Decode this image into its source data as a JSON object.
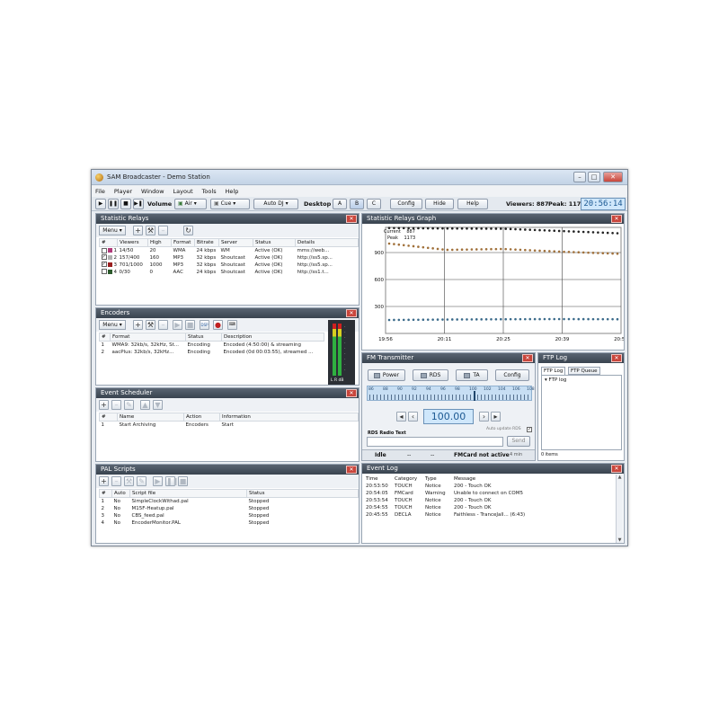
{
  "window": {
    "title": "SAM Broadcaster - Demo Station"
  },
  "menu": [
    "File",
    "Player",
    "Window",
    "Layout",
    "Tools",
    "Help"
  ],
  "toolbar": {
    "volume_label": "Volume",
    "air": "Air",
    "cue": "Cue",
    "autodj": "Auto DJ",
    "desktop_label": "Desktop",
    "desktop_buttons": [
      "A",
      "B",
      "C"
    ],
    "config": "Config",
    "hide": "Hide",
    "help": "Help",
    "viewers": "Viewers: 887",
    "peak": "Peak: 1173",
    "clock": "20:56:14"
  },
  "statistic_relays": {
    "title": "Statistic Relays",
    "menu": "Menu",
    "columns": [
      "#",
      "Viewers",
      "High",
      "Format",
      "Bitrate",
      "Server",
      "Status",
      "Details"
    ],
    "rows": [
      {
        "num": "1",
        "viewers": "14/50",
        "high": "20",
        "format": "WMA",
        "bitrate": "24 kbps",
        "server": "WM",
        "status": "Active (OK)",
        "details": "mms://web...",
        "checked": false,
        "color": "#b03a7a"
      },
      {
        "num": "2",
        "viewers": "157/400",
        "high": "160",
        "format": "MP3",
        "bitrate": "32 kbps",
        "server": "Shoutcast",
        "status": "Active (OK)",
        "details": "http://ss5.sp...",
        "checked": true,
        "color": "#b0b0b0"
      },
      {
        "num": "3",
        "viewers": "701/1000",
        "high": "1000",
        "format": "MP3",
        "bitrate": "32 kbps",
        "server": "Shoutcast",
        "status": "Active (OK)",
        "details": "http://ss5.sp...",
        "checked": true,
        "color": "#9a2020"
      },
      {
        "num": "4",
        "viewers": "0/30",
        "high": "0",
        "format": "AAC",
        "bitrate": "24 kbps",
        "server": "Shoutcast",
        "status": "Active (OK)",
        "details": "http://ss1.t...",
        "checked": false,
        "color": "#2d5a2d"
      }
    ]
  },
  "graph": {
    "title": "Statistic Relays Graph",
    "legend_current": "Current",
    "legend_current_value": "887",
    "legend_peak": "Peak",
    "legend_peak_value": "1173",
    "y_ticks": [
      "900",
      "600",
      "300"
    ],
    "x_ticks": [
      "19:56",
      "20:11",
      "20:25",
      "20:39",
      "20:54"
    ]
  },
  "chart_data": {
    "type": "scatter",
    "x": [
      "19:56",
      "20:11",
      "20:25",
      "20:39",
      "20:54"
    ],
    "ylim": [
      0,
      1180
    ],
    "series": [
      {
        "name": "Peak",
        "values": [
          1173,
          1168,
          1165,
          1140,
          1115
        ],
        "color": "#222222"
      },
      {
        "name": "Current",
        "values": [
          1000,
          930,
          940,
          910,
          887
        ],
        "color": "#a0703a"
      },
      {
        "values": [
          150,
          155,
          158,
          160,
          158
        ],
        "color": "#3a6a8a"
      }
    ]
  },
  "encoders": {
    "title": "Encoders",
    "menu": "Menu",
    "columns": [
      "#",
      "Format",
      "Status",
      "Description"
    ],
    "rows": [
      {
        "num": "1",
        "format": "WMA9: 32kb/s, 32kHz, St...",
        "status": "Encoding",
        "description": "Encoded (4:50:00) & streaming"
      },
      {
        "num": "2",
        "format": "aacPlus: 32kb/s, 32kHz...",
        "status": "Encoding",
        "description": "Encoded (0d 00:03:55), streamed ..."
      }
    ],
    "vu_label": "L R dB"
  },
  "event_scheduler": {
    "title": "Event Scheduler",
    "columns": [
      "#",
      "Name",
      "Action",
      "Information"
    ],
    "rows": [
      {
        "num": "1",
        "name": "Start Archiving",
        "action": "Encoders",
        "info": "Start"
      }
    ]
  },
  "pal_scripts": {
    "title": "PAL Scripts",
    "columns": [
      "#",
      "Auto",
      "Script file",
      "Status"
    ],
    "rows": [
      {
        "num": "1",
        "auto": "No",
        "file": "SimpleClockWithad.pal",
        "status": "Stopped"
      },
      {
        "num": "2",
        "auto": "No",
        "file": "M15F-Heatup.pal",
        "status": "Stopped"
      },
      {
        "num": "3",
        "auto": "No",
        "file": "CBS_feed.pal",
        "status": "Stopped"
      },
      {
        "num": "4",
        "auto": "No",
        "file": "EncoderMonitor.PAL",
        "status": "Stopped"
      }
    ]
  },
  "fm": {
    "title": "FM Transmitter",
    "power": "Power",
    "rds": "RDS",
    "ta": "TA",
    "config": "Config",
    "scale": [
      "86",
      "88",
      "90",
      "92",
      "94",
      "96",
      "98",
      "100",
      "102",
      "104",
      "106",
      "108"
    ],
    "frequency": "100.00",
    "auto_update": "Auto update RDS",
    "rds_text_label": "RDS Radio Text",
    "send": "Send",
    "status_idle": "Idle",
    "status_a": "--",
    "status_b": "--",
    "status_card": "FMCard not active",
    "status_right": "4 min"
  },
  "ftp": {
    "title": "FTP Log",
    "tab_log": "FTP Log",
    "tab_queue": "FTP Queue",
    "tree_item": "FTP log",
    "status": "0 items"
  },
  "event_log": {
    "title": "Event Log",
    "columns": [
      "Time",
      "Category",
      "Type",
      "Message"
    ],
    "rows": [
      {
        "time": "20:53:50",
        "cat": "TOUCH",
        "type": "Notice",
        "msg": "200 - Touch OK"
      },
      {
        "time": "20:54:05",
        "cat": "FMCard",
        "type": "Warning",
        "msg": "Unable to connect on COM5"
      },
      {
        "time": "20:53:54",
        "cat": "TOUCH",
        "type": "Notice",
        "msg": "200 - Touch OK"
      },
      {
        "time": "20:54:55",
        "cat": "TOUCH",
        "type": "Notice",
        "msg": "200 - Touch OK"
      },
      {
        "time": "20:45:55",
        "cat": "DECLA",
        "type": "Notice",
        "msg": "Faithless - TranceJall... (6:43)"
      }
    ]
  }
}
